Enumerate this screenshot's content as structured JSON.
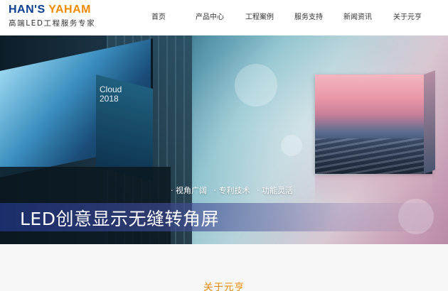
{
  "brand": {
    "name_part1": "HAN'S",
    "name_part2": "YAHAM",
    "tagline": "高端LED工程服务专家"
  },
  "nav": {
    "items": [
      {
        "label": "首页"
      },
      {
        "label": "产品中心"
      },
      {
        "label": "工程案例"
      },
      {
        "label": "服务支持"
      },
      {
        "label": "新闻资讯"
      },
      {
        "label": "关于元亨"
      }
    ]
  },
  "banner": {
    "screen_text": [
      "Cloud",
      "2018"
    ],
    "features": [
      "· 视角广阔",
      "· 专利技术",
      "· 功能灵活"
    ],
    "title": "LED创意显示无缝转角屏"
  },
  "about": {
    "title": "关于元亨"
  },
  "colors": {
    "brand_blue": "#0b3d91",
    "brand_orange": "#f08a00",
    "about_title": "#e58a00"
  }
}
